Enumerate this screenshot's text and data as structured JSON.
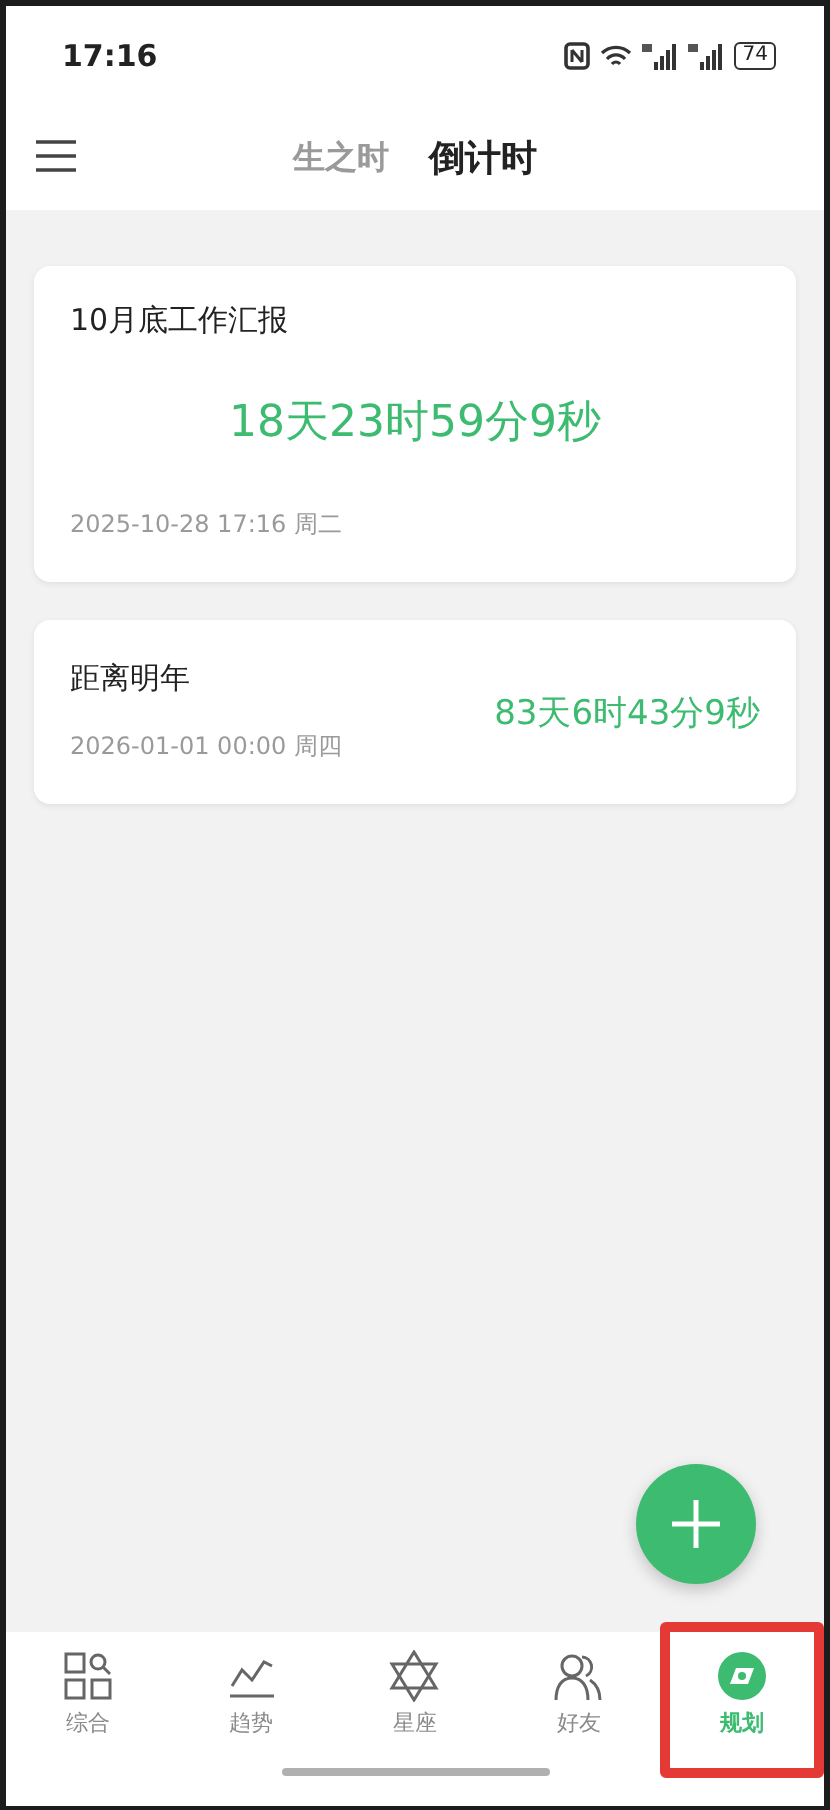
{
  "status_bar": {
    "time": "17:16",
    "battery": "74"
  },
  "header": {
    "tabs": [
      {
        "label": "生之时",
        "selected": false
      },
      {
        "label": "倒计时",
        "selected": true
      }
    ]
  },
  "countdowns": [
    {
      "kind": "featured",
      "title": "10月底工作汇报",
      "remaining": "18天23时59分9秒",
      "date": "2025-10-28 17:16 周二"
    },
    {
      "kind": "compact",
      "title": "距离明年",
      "remaining": "83天6时43分9秒",
      "date": "2026-01-01 00:00 周四"
    }
  ],
  "tab_bar": [
    {
      "kind": "overview",
      "label": "综合",
      "selected": false,
      "highlighted": false
    },
    {
      "kind": "trend",
      "label": "趋势",
      "selected": false,
      "highlighted": false
    },
    {
      "kind": "star",
      "label": "星座",
      "selected": false,
      "highlighted": false
    },
    {
      "kind": "friends",
      "label": "好友",
      "selected": false,
      "highlighted": false
    },
    {
      "kind": "plan",
      "label": "规划",
      "selected": true,
      "highlighted": true
    }
  ]
}
